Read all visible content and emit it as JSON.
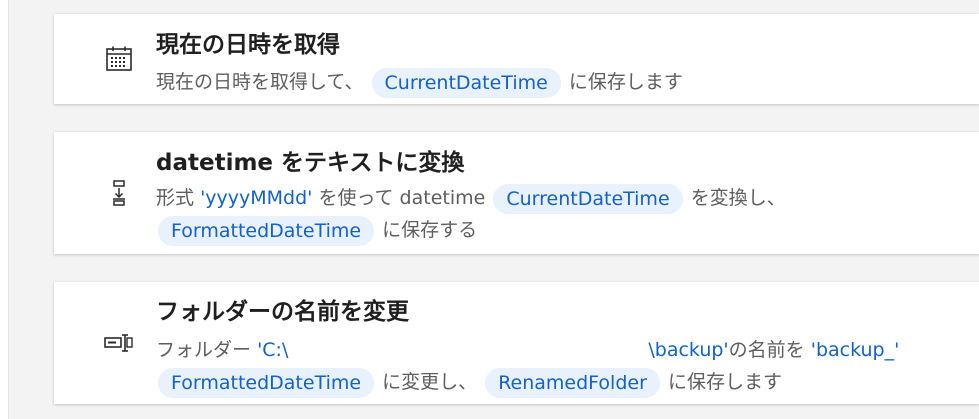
{
  "actions": [
    {
      "icon": "calendar-icon",
      "title": "現在の日時を取得",
      "description": {
        "text_1": "現在の日時を取得して、",
        "chip_1": "CurrentDateTime",
        "text_2": "に保存します"
      }
    },
    {
      "icon": "text-convert-icon",
      "title": "datetime をテキストに変換",
      "description": {
        "text_1": "形式",
        "value_1": "'yyyyMMdd'",
        "text_2": "を使って datetime",
        "chip_1": "CurrentDateTime",
        "text_3": "を変換し、",
        "chip_2": "FormattedDateTime",
        "text_4": "に保存する"
      }
    },
    {
      "icon": "rename-folder-icon",
      "title": "フォルダーの名前を変更",
      "description": {
        "text_1": "フォルダー",
        "value_1": "'C:\\",
        "value_2": "\\backup'",
        "text_2": "の名前を",
        "value_3": "'backup_'",
        "chip_1": "FormattedDateTime",
        "text_3": "に変更し、",
        "chip_2": "RenamedFolder",
        "text_4": "に保存します"
      }
    }
  ]
}
